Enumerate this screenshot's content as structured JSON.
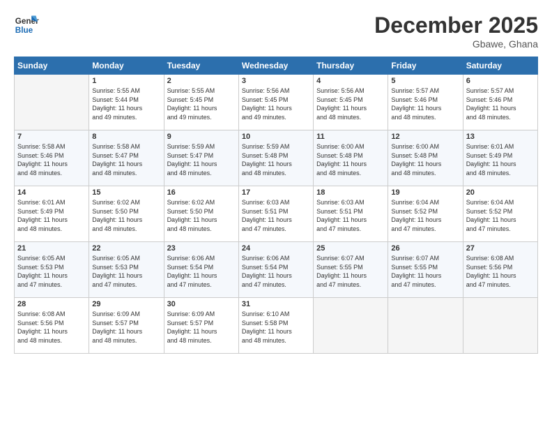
{
  "header": {
    "logo_text_general": "General",
    "logo_text_blue": "Blue",
    "month_title": "December 2025",
    "location": "Gbawe, Ghana"
  },
  "days_of_week": [
    "Sunday",
    "Monday",
    "Tuesday",
    "Wednesday",
    "Thursday",
    "Friday",
    "Saturday"
  ],
  "weeks": [
    [
      {
        "day": "",
        "sunrise": "",
        "sunset": "",
        "daylight": ""
      },
      {
        "day": "1",
        "sunrise": "Sunrise: 5:55 AM",
        "sunset": "Sunset: 5:44 PM",
        "daylight": "Daylight: 11 hours and 49 minutes."
      },
      {
        "day": "2",
        "sunrise": "Sunrise: 5:55 AM",
        "sunset": "Sunset: 5:45 PM",
        "daylight": "Daylight: 11 hours and 49 minutes."
      },
      {
        "day": "3",
        "sunrise": "Sunrise: 5:56 AM",
        "sunset": "Sunset: 5:45 PM",
        "daylight": "Daylight: 11 hours and 49 minutes."
      },
      {
        "day": "4",
        "sunrise": "Sunrise: 5:56 AM",
        "sunset": "Sunset: 5:45 PM",
        "daylight": "Daylight: 11 hours and 48 minutes."
      },
      {
        "day": "5",
        "sunrise": "Sunrise: 5:57 AM",
        "sunset": "Sunset: 5:46 PM",
        "daylight": "Daylight: 11 hours and 48 minutes."
      },
      {
        "day": "6",
        "sunrise": "Sunrise: 5:57 AM",
        "sunset": "Sunset: 5:46 PM",
        "daylight": "Daylight: 11 hours and 48 minutes."
      }
    ],
    [
      {
        "day": "7",
        "sunrise": "Sunrise: 5:58 AM",
        "sunset": "Sunset: 5:46 PM",
        "daylight": "Daylight: 11 hours and 48 minutes."
      },
      {
        "day": "8",
        "sunrise": "Sunrise: 5:58 AM",
        "sunset": "Sunset: 5:47 PM",
        "daylight": "Daylight: 11 hours and 48 minutes."
      },
      {
        "day": "9",
        "sunrise": "Sunrise: 5:59 AM",
        "sunset": "Sunset: 5:47 PM",
        "daylight": "Daylight: 11 hours and 48 minutes."
      },
      {
        "day": "10",
        "sunrise": "Sunrise: 5:59 AM",
        "sunset": "Sunset: 5:48 PM",
        "daylight": "Daylight: 11 hours and 48 minutes."
      },
      {
        "day": "11",
        "sunrise": "Sunrise: 6:00 AM",
        "sunset": "Sunset: 5:48 PM",
        "daylight": "Daylight: 11 hours and 48 minutes."
      },
      {
        "day": "12",
        "sunrise": "Sunrise: 6:00 AM",
        "sunset": "Sunset: 5:48 PM",
        "daylight": "Daylight: 11 hours and 48 minutes."
      },
      {
        "day": "13",
        "sunrise": "Sunrise: 6:01 AM",
        "sunset": "Sunset: 5:49 PM",
        "daylight": "Daylight: 11 hours and 48 minutes."
      }
    ],
    [
      {
        "day": "14",
        "sunrise": "Sunrise: 6:01 AM",
        "sunset": "Sunset: 5:49 PM",
        "daylight": "Daylight: 11 hours and 48 minutes."
      },
      {
        "day": "15",
        "sunrise": "Sunrise: 6:02 AM",
        "sunset": "Sunset: 5:50 PM",
        "daylight": "Daylight: 11 hours and 48 minutes."
      },
      {
        "day": "16",
        "sunrise": "Sunrise: 6:02 AM",
        "sunset": "Sunset: 5:50 PM",
        "daylight": "Daylight: 11 hours and 48 minutes."
      },
      {
        "day": "17",
        "sunrise": "Sunrise: 6:03 AM",
        "sunset": "Sunset: 5:51 PM",
        "daylight": "Daylight: 11 hours and 47 minutes."
      },
      {
        "day": "18",
        "sunrise": "Sunrise: 6:03 AM",
        "sunset": "Sunset: 5:51 PM",
        "daylight": "Daylight: 11 hours and 47 minutes."
      },
      {
        "day": "19",
        "sunrise": "Sunrise: 6:04 AM",
        "sunset": "Sunset: 5:52 PM",
        "daylight": "Daylight: 11 hours and 47 minutes."
      },
      {
        "day": "20",
        "sunrise": "Sunrise: 6:04 AM",
        "sunset": "Sunset: 5:52 PM",
        "daylight": "Daylight: 11 hours and 47 minutes."
      }
    ],
    [
      {
        "day": "21",
        "sunrise": "Sunrise: 6:05 AM",
        "sunset": "Sunset: 5:53 PM",
        "daylight": "Daylight: 11 hours and 47 minutes."
      },
      {
        "day": "22",
        "sunrise": "Sunrise: 6:05 AM",
        "sunset": "Sunset: 5:53 PM",
        "daylight": "Daylight: 11 hours and 47 minutes."
      },
      {
        "day": "23",
        "sunrise": "Sunrise: 6:06 AM",
        "sunset": "Sunset: 5:54 PM",
        "daylight": "Daylight: 11 hours and 47 minutes."
      },
      {
        "day": "24",
        "sunrise": "Sunrise: 6:06 AM",
        "sunset": "Sunset: 5:54 PM",
        "daylight": "Daylight: 11 hours and 47 minutes."
      },
      {
        "day": "25",
        "sunrise": "Sunrise: 6:07 AM",
        "sunset": "Sunset: 5:55 PM",
        "daylight": "Daylight: 11 hours and 47 minutes."
      },
      {
        "day": "26",
        "sunrise": "Sunrise: 6:07 AM",
        "sunset": "Sunset: 5:55 PM",
        "daylight": "Daylight: 11 hours and 47 minutes."
      },
      {
        "day": "27",
        "sunrise": "Sunrise: 6:08 AM",
        "sunset": "Sunset: 5:56 PM",
        "daylight": "Daylight: 11 hours and 47 minutes."
      }
    ],
    [
      {
        "day": "28",
        "sunrise": "Sunrise: 6:08 AM",
        "sunset": "Sunset: 5:56 PM",
        "daylight": "Daylight: 11 hours and 48 minutes."
      },
      {
        "day": "29",
        "sunrise": "Sunrise: 6:09 AM",
        "sunset": "Sunset: 5:57 PM",
        "daylight": "Daylight: 11 hours and 48 minutes."
      },
      {
        "day": "30",
        "sunrise": "Sunrise: 6:09 AM",
        "sunset": "Sunset: 5:57 PM",
        "daylight": "Daylight: 11 hours and 48 minutes."
      },
      {
        "day": "31",
        "sunrise": "Sunrise: 6:10 AM",
        "sunset": "Sunset: 5:58 PM",
        "daylight": "Daylight: 11 hours and 48 minutes."
      },
      {
        "day": "",
        "sunrise": "",
        "sunset": "",
        "daylight": ""
      },
      {
        "day": "",
        "sunrise": "",
        "sunset": "",
        "daylight": ""
      },
      {
        "day": "",
        "sunrise": "",
        "sunset": "",
        "daylight": ""
      }
    ]
  ]
}
